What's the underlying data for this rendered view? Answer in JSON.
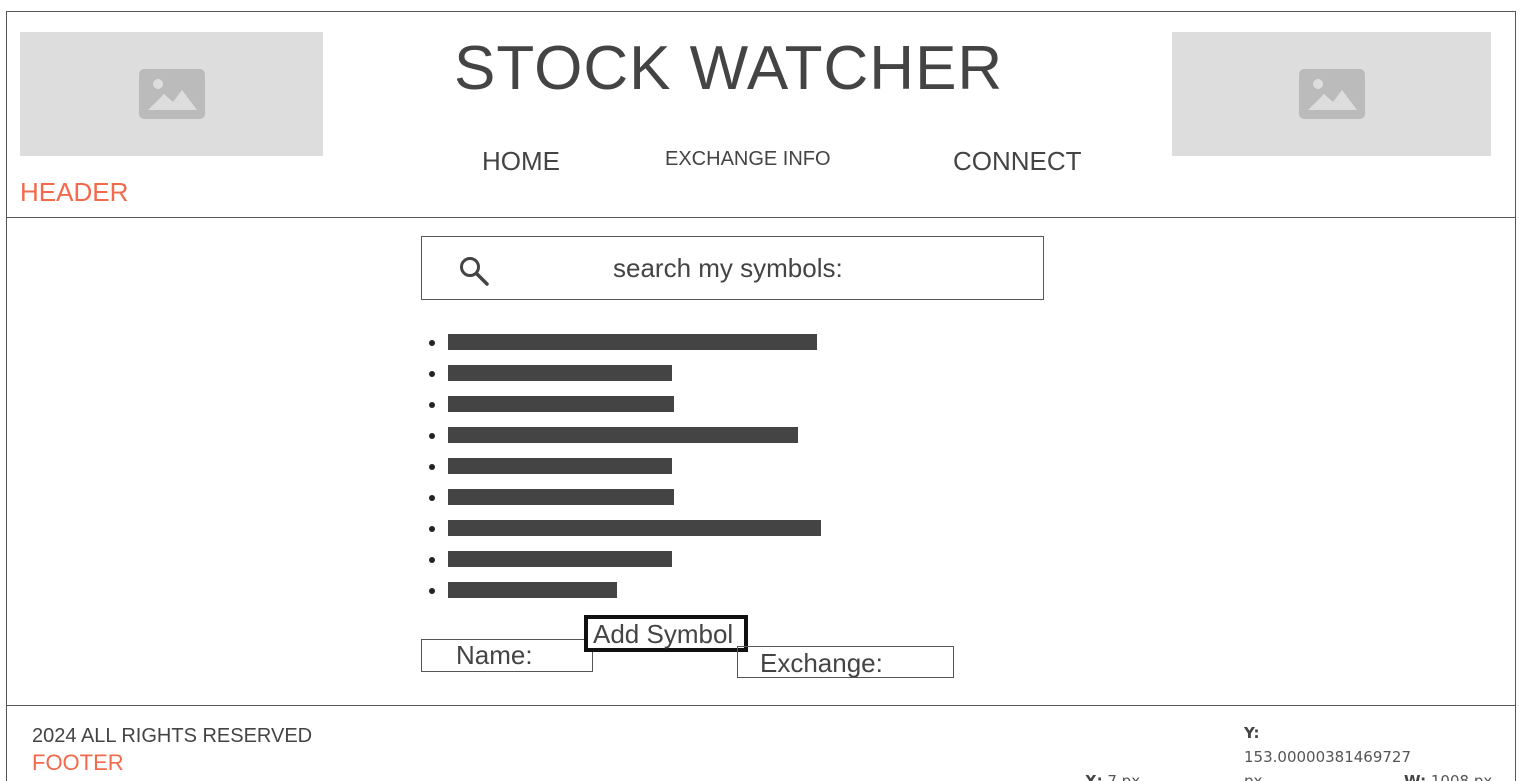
{
  "header": {
    "title": "STOCK WATCHER",
    "label": "HEADER",
    "nav": {
      "home": "HOME",
      "exchange_info": "EXCHANGE INFO",
      "connect": "CONNECT"
    }
  },
  "search": {
    "placeholder": "search my symbols:"
  },
  "symbols": {
    "item_count": 9
  },
  "add_form": {
    "name_label": "Name:",
    "add_button": "Add Symbol",
    "exchange_label": "Exchange:"
  },
  "footer": {
    "copyright": "2024 ALL RIGHTS RESERVED",
    "label": "FOOTER"
  },
  "readout": {
    "y_label": "Y:",
    "y_value": "153.00000381469727",
    "y_unit": "px",
    "x_label": "X:",
    "x_value": "7 px",
    "w_label": "W:",
    "w_value": "1008 px"
  },
  "colors": {
    "accent": "#f26a4b",
    "text": "#444444",
    "placeholder_bg": "#dddddd",
    "placeholder_icon": "#bbbbbb"
  },
  "icons": {
    "image_placeholder": "image-icon",
    "search": "search-icon"
  }
}
